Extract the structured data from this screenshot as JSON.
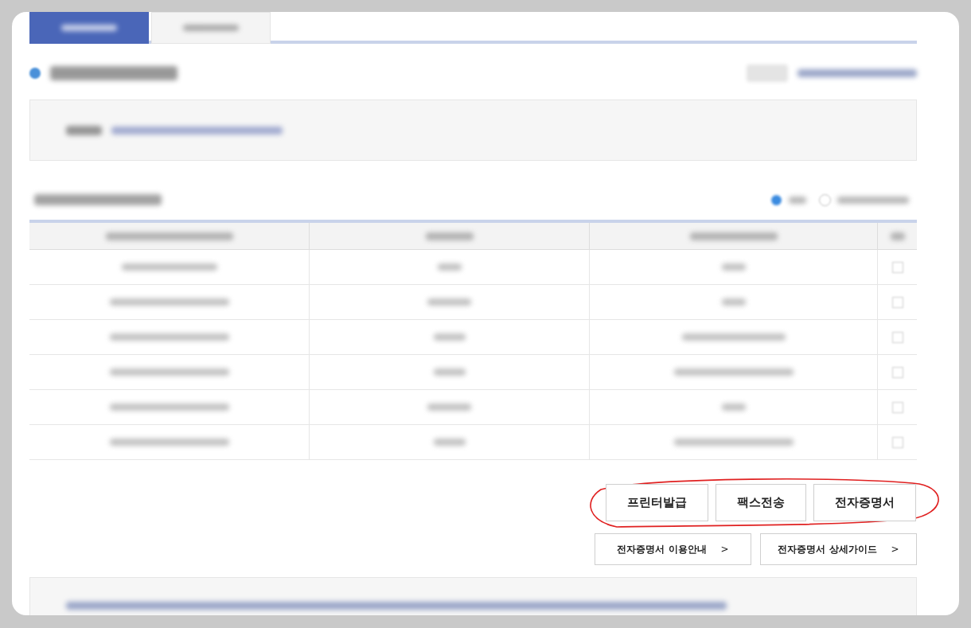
{
  "tabs": [
    {
      "selected": true
    },
    {
      "selected": false
    }
  ],
  "radio_options": [
    {
      "selected": true
    },
    {
      "selected": false
    }
  ],
  "table": {
    "rows": [
      {
        "checked": false
      },
      {
        "checked": false
      },
      {
        "checked": false
      },
      {
        "checked": false
      },
      {
        "checked": false
      },
      {
        "checked": false
      }
    ]
  },
  "action_buttons": [
    "프린터발급",
    "팩스전송",
    "전자증명서"
  ],
  "guide_links": [
    {
      "label": "전자증명서 이용안내",
      "arrow": ">"
    },
    {
      "label": "전자증명서 상세가이드",
      "arrow": ">"
    }
  ]
}
